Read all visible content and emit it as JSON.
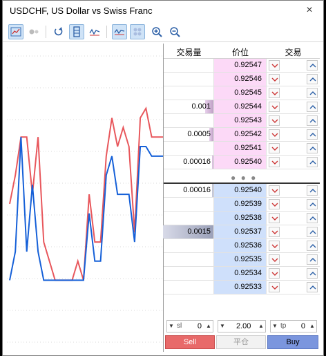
{
  "window": {
    "title": "USDCHF, US Dollar vs Swiss Franc",
    "close_icon": "×"
  },
  "toolbar": {
    "buttons": [
      {
        "name": "chart-icon",
        "active": true
      },
      {
        "name": "settings-icon",
        "active": false
      },
      {
        "name": "rotate-icon",
        "active": false
      },
      {
        "name": "one-click-icon",
        "active": true
      },
      {
        "name": "tick-chart-icon",
        "active": false
      },
      {
        "name": "line-chart-icon",
        "active": true
      },
      {
        "name": "scatter-icon",
        "active": false
      },
      {
        "name": "zoom-in-icon",
        "active": false
      },
      {
        "name": "zoom-out-icon",
        "active": false
      }
    ]
  },
  "dom": {
    "headers": {
      "volume": "交易量",
      "price": "价位",
      "trade": "交易"
    },
    "ask_rows": [
      {
        "volume": "",
        "price": "0.92547",
        "bar": 0
      },
      {
        "volume": "",
        "price": "0.92546",
        "bar": 0
      },
      {
        "volume": "",
        "price": "0.92545",
        "bar": 0
      },
      {
        "volume": "0.001",
        "price": "0.92544",
        "bar": 0.16
      },
      {
        "volume": "",
        "price": "0.92543",
        "bar": 0
      },
      {
        "volume": "0.0005",
        "price": "0.92542",
        "bar": 0.08
      },
      {
        "volume": "",
        "price": "0.92541",
        "bar": 0
      },
      {
        "volume": "0.00016",
        "price": "0.92540",
        "bar": 0.03
      }
    ],
    "spread_dots": "● ● ●",
    "bid_rows": [
      {
        "volume": "0.00016",
        "price": "0.92540",
        "bar": 0.03
      },
      {
        "volume": "",
        "price": "0.92539",
        "bar": 0
      },
      {
        "volume": "",
        "price": "0.92538",
        "bar": 0
      },
      {
        "volume": "0.0015",
        "price": "0.92537",
        "bar": 1.0
      },
      {
        "volume": "",
        "price": "0.92536",
        "bar": 0
      },
      {
        "volume": "",
        "price": "0.92535",
        "bar": 0
      },
      {
        "volume": "",
        "price": "0.92534",
        "bar": 0
      },
      {
        "volume": "",
        "price": "0.92533",
        "bar": 0
      }
    ]
  },
  "controls": {
    "sl_label": "sl",
    "sl_value": "0",
    "lot_value": "2.00",
    "tp_label": "tp",
    "tp_value": "0",
    "sell_label": "Sell",
    "close_label": "平仓",
    "buy_label": "Buy"
  },
  "colors": {
    "ask_line": "#e8575c",
    "bid_line": "#1560d8",
    "ask_bg": "#fcd9f7",
    "bid_bg": "#cfe0fb"
  },
  "chart_data": {
    "type": "line",
    "series": [
      {
        "values": [
          0.9254,
          0.92543,
          0.92547,
          0.92547,
          0.92541,
          0.92547,
          0.92536,
          0.92534,
          0.92532,
          0.92532,
          0.92532,
          0.92532,
          0.92534,
          0.92532,
          0.92541,
          0.92536,
          0.92536,
          0.92545,
          0.92549,
          0.92546,
          0.92548,
          0.92546,
          0.92537,
          0.92549,
          0.9255,
          0.92547,
          0.92547,
          0.92547
        ]
      },
      {
        "values": [
          0.92532,
          0.92535,
          0.92547,
          0.92535,
          0.92542,
          0.92535,
          0.92532,
          0.92532,
          0.92532,
          0.92532,
          0.92532,
          0.92532,
          0.92532,
          0.92532,
          0.92539,
          0.92534,
          0.92534,
          0.92543,
          0.92545,
          0.92541,
          0.92541,
          0.92541,
          0.92536,
          0.92546,
          0.92546,
          0.92545,
          0.92545,
          0.92545
        ]
      }
    ]
  }
}
